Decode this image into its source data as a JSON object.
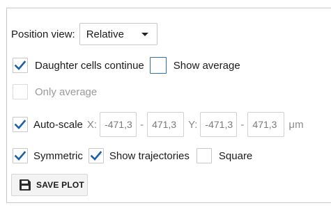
{
  "position_view": {
    "label": "Position view:",
    "selected": "Relative"
  },
  "checkboxes": {
    "daughter_cells": {
      "label": "Daughter cells continue",
      "checked": true
    },
    "show_average": {
      "label": "Show average",
      "checked": false
    },
    "only_average": {
      "label": "Only average",
      "checked": false,
      "disabled": true
    },
    "auto_scale": {
      "label": "Auto-scale",
      "checked": true
    },
    "symmetric": {
      "label": "Symmetric",
      "checked": true
    },
    "show_trajectories": {
      "label": "Show trajectories",
      "checked": true
    },
    "square": {
      "label": "Square",
      "checked": false
    }
  },
  "range": {
    "x_label": "X:",
    "x_min": "-471,3",
    "x_max": "471,3",
    "y_label": "Y:",
    "y_min": "-471,3",
    "y_max": "471,3",
    "separator": "-",
    "unit": "μm"
  },
  "save_button": {
    "label": "SAVE PLOT",
    "icon": "floppy-disk-icon"
  },
  "colors": {
    "check": "#1a5fa8",
    "border": "#c8c8c8",
    "focus_border": "#2a6fb3",
    "disabled_text": "#9a9a9a"
  }
}
